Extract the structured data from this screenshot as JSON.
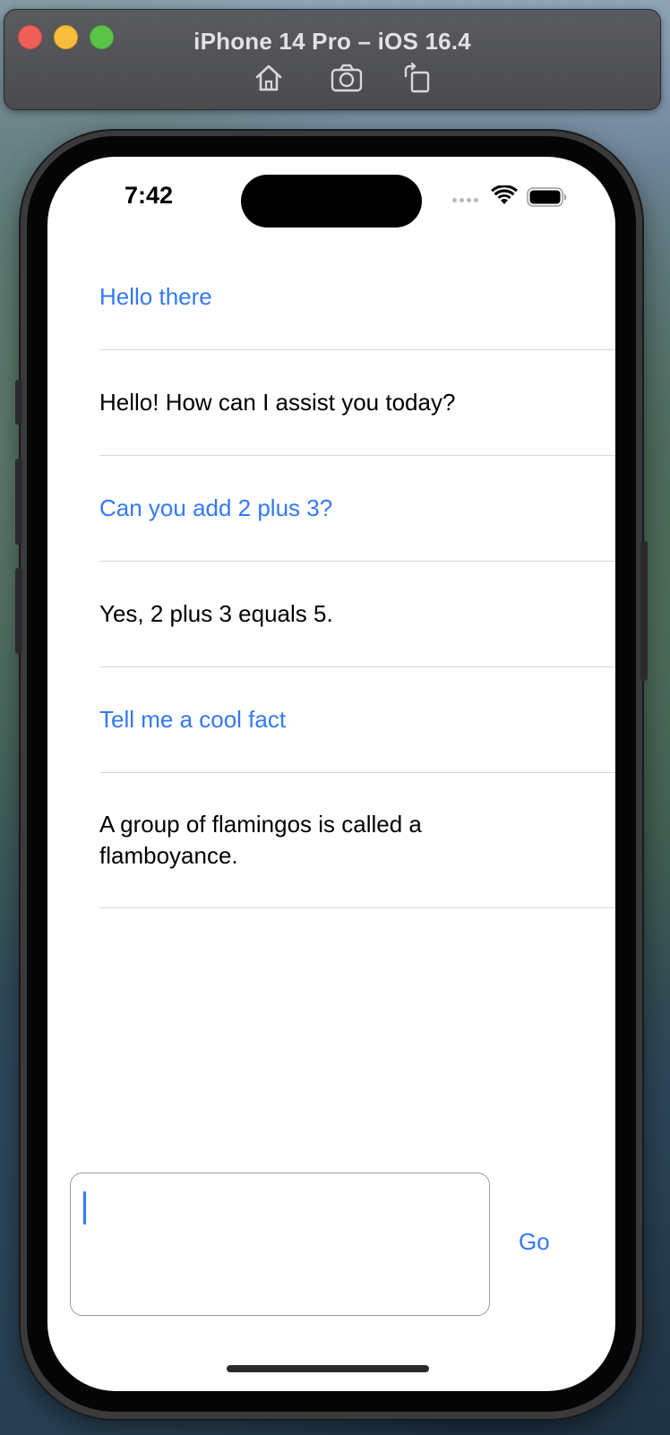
{
  "simulator": {
    "title": "iPhone 14 Pro – iOS 16.4",
    "tools": [
      {
        "icon": "home-icon"
      },
      {
        "icon": "screenshot-camera-icon"
      },
      {
        "icon": "rotate-icon"
      }
    ]
  },
  "status_bar": {
    "time": "7:42",
    "icons": [
      "cellular-signal-icon",
      "wifi-icon",
      "battery-icon"
    ]
  },
  "messages": [
    {
      "role": "user",
      "text": "Hello there"
    },
    {
      "role": "assistant",
      "text": "Hello! How can I assist you today?"
    },
    {
      "role": "user",
      "text": "Can you add 2 plus 3?"
    },
    {
      "role": "assistant",
      "text": "Yes, 2 plus 3 equals 5."
    },
    {
      "role": "user",
      "text": "Tell me a cool fact"
    },
    {
      "role": "assistant",
      "text": "A group of flamingos is called a flamboyance."
    }
  ],
  "composer": {
    "value": "",
    "go_label": "Go"
  },
  "colors": {
    "accent": "#3478f6",
    "separator": "#d8d8dc"
  }
}
